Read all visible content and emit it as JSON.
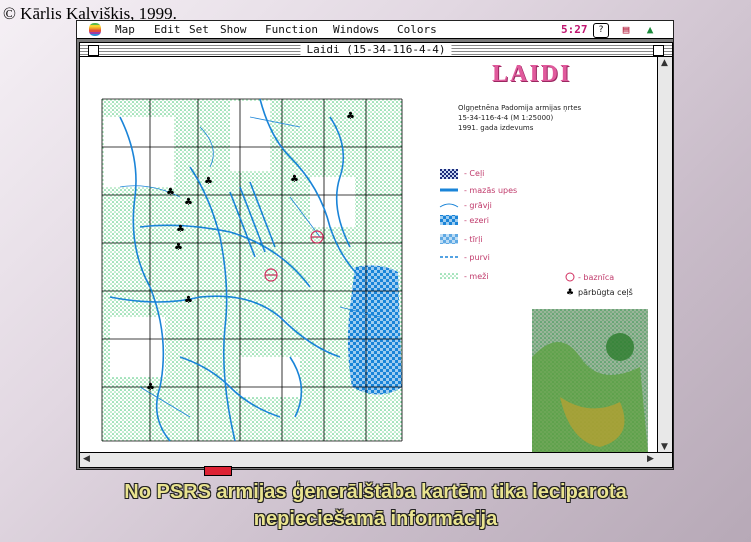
{
  "copyright": "© Kārlis Kalviškis, 1999.",
  "menubar": {
    "items": [
      "Map",
      "Edit",
      "Set",
      "Show",
      "Function",
      "Windows",
      "Colors"
    ],
    "clock": "5:27",
    "icons": [
      "help-icon",
      "document-icon",
      "application-icon"
    ]
  },
  "window": {
    "title": "Laidi (15-34-116-4-4)"
  },
  "map": {
    "title": "LAIDI",
    "info_lines": [
      "Olgņetnēna Padomija armijas ņrtes",
      "15-34-116-4-4 (M 1:25000)",
      "1991. gada izdevums"
    ],
    "legend": [
      {
        "label": "- Ceļi",
        "pattern": "dark-check"
      },
      {
        "label": "- mazās upes",
        "pattern": "blue-line"
      },
      {
        "label": "- grāvji",
        "pattern": "blue-thin"
      },
      {
        "label": "- ezeri",
        "pattern": "blue-dots"
      },
      {
        "label": "- tīrļi",
        "pattern": "blue-check"
      },
      {
        "label": "- purvi",
        "pattern": "blue-dash"
      },
      {
        "label": "- meži",
        "pattern": "green-dots"
      }
    ],
    "legend_right": [
      {
        "label": "- baznīca",
        "symbol": "church-icon"
      },
      {
        "label": "pārbūgta ceļš",
        "symbol": "tree-icon"
      }
    ]
  },
  "caption": {
    "line1": "No PSRS armijas ģenerālštāba kartēm tika ieciparota",
    "line2": "nepieciešamā informācija"
  },
  "colors": {
    "accent": "#e05a9c",
    "water": "#1a84d8",
    "forest": "#3cc470",
    "caption": "#e9e38f"
  }
}
